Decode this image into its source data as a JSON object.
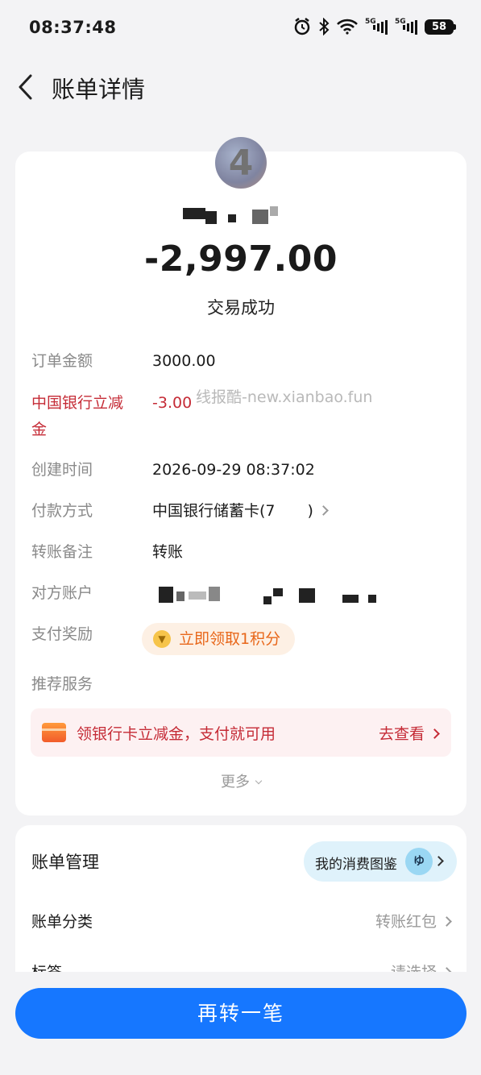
{
  "status": {
    "time": "08:37:48",
    "network": "5G",
    "battery": "58"
  },
  "nav": {
    "title": "账单详情"
  },
  "summary": {
    "avatar_text": "4",
    "amount": "-2,997.00",
    "status": "交易成功"
  },
  "details": [
    {
      "label": "订单金额",
      "value": "3000.00"
    },
    {
      "label": "中国银行立减金",
      "value": "-3.00"
    },
    {
      "label": "创建时间",
      "value": "2026-09-29 08:37:02"
    },
    {
      "label": "付款方式",
      "value": "中国银行储蓄卡(7"
    },
    {
      "label": "转账备注",
      "value": "转账"
    },
    {
      "label": "对方账户",
      "value": ""
    },
    {
      "label": "支付奖励",
      "value": ""
    },
    {
      "label": "推荐服务",
      "value": ""
    }
  ],
  "watermark": "线报酷-new.xianbao.fun",
  "reward": {
    "label": "立即领取1积分"
  },
  "promo": {
    "text": "领银行卡立减金，支付就可用",
    "action": "去查看"
  },
  "more": {
    "label": "更多"
  },
  "bill": {
    "title": "账单管理",
    "album": "我的消费图鉴",
    "rows": [
      {
        "label": "账单分类",
        "value": "转账红包"
      },
      {
        "label": "标签",
        "value": "请选择"
      }
    ]
  },
  "cta": {
    "label": "再转一笔"
  }
}
